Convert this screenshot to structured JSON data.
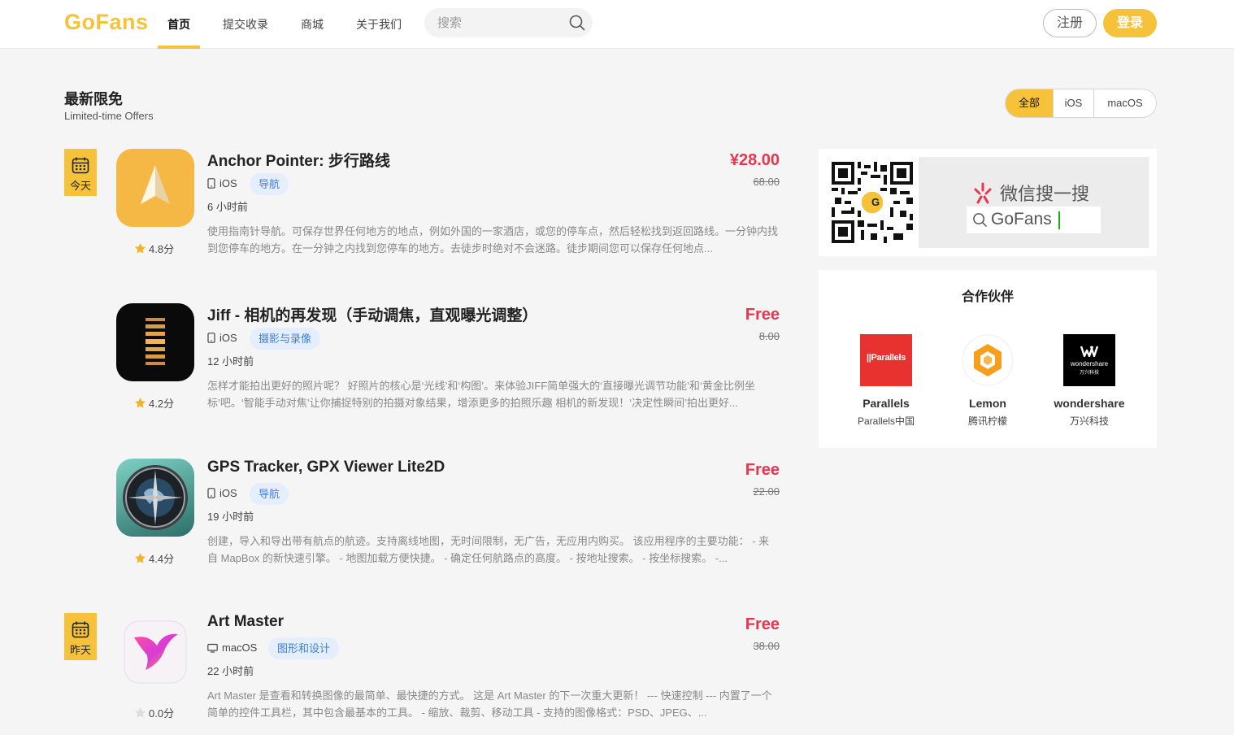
{
  "header": {
    "logo": "GoFans",
    "nav": [
      {
        "label": "首页"
      },
      {
        "label": "提交收录"
      },
      {
        "label": "商城"
      },
      {
        "label": "关于我们"
      }
    ],
    "search_placeholder": "搜索",
    "register_label": "注册",
    "login_label": "登录"
  },
  "section": {
    "title": "最新限免",
    "subtitle": "Limited-time Offers",
    "filters": [
      "全部",
      "iOS",
      "macOS"
    ],
    "active_filter": "全部"
  },
  "apps": [
    {
      "day": "今天",
      "name": "Anchor Pointer: 步行路线",
      "platform": "iOS",
      "platform_icon": "phone-icon",
      "category": "导航",
      "time": "6 小时前",
      "desc": "使用指南针导航。可保存世界任何地方的地点，例如外国的一家酒店，或您的停车点，然后轻松找到返回路线。一分钟内找到您停车的地方。在一分钟之内找到您停车的地方。去徒步时绝对不会迷路。徒步期间您可以保存任何地点...",
      "price": "¥28.00",
      "original_price": "68.00",
      "rating": "4.8分",
      "icon": "anchor-pointer-app-icon"
    },
    {
      "day": "",
      "name": "Jiff - 相机的再发现（手动调焦，直观曝光调整）",
      "platform": "iOS",
      "platform_icon": "phone-icon",
      "category": "摄影与录像",
      "time": "12 小时前",
      "desc": "怎样才能拍出更好的照片呢？ 好照片的核心是‘光线’和‘构图’。来体验JIFF简单强大的‘直接曝光调节功能’和‘黄金比例坐标’吧。‘智能手动对焦’让你捕捉特别的拍摄对象结果，增添更多的拍照乐趣 相机的新发现！‘决定性瞬间’拍出更好...",
      "price": "Free",
      "original_price": "8.00",
      "rating": "4.2分",
      "icon": "jiff-app-icon"
    },
    {
      "day": "",
      "name": "GPS Tracker, GPX Viewer Lite2D",
      "platform": "iOS",
      "platform_icon": "phone-icon",
      "category": "导航",
      "time": "19 小时前",
      "desc": "创建，导入和导出带有航点的航迹。支持离线地图，无时间限制，无广告，无应用内购买。 该应用程序的主要功能： - 来自 MapBox 的新快速引擎。 - 地图加载方便快捷。 - 确定任何航路点的高度。 - 按地址搜索。 - 按坐标搜索。 -...",
      "price": "Free",
      "original_price": "22.00",
      "rating": "4.4分",
      "icon": "gps-tracker-app-icon"
    },
    {
      "day": "昨天",
      "name": "Art Master",
      "platform": "macOS",
      "platform_icon": "monitor-icon",
      "category": "图形和设计",
      "time": "22 小时前",
      "desc": "Art Master 是查看和转换图像的最简单、最快捷的方式。 这是 Art Master 的下一次重大更新！ --- 快速控制 --- 内置了一个简单的控件工具栏，其中包含最基本的工具。 - 缩放、裁剪、移动工具 - 支持的图像格式：PSD、JPEG、...",
      "price": "Free",
      "original_price": "38.00",
      "rating": "0.0分",
      "icon": "art-master-app-icon"
    }
  ],
  "wechat": {
    "title": "微信搜一搜",
    "query": "GoFans",
    "logo_letter": "G"
  },
  "partners": {
    "title": "合作伙伴",
    "items": [
      {
        "name": "Parallels",
        "desc": "Parallels中国",
        "logo_text": "||Parallels"
      },
      {
        "name": "Lemon",
        "desc": "腾讯柠檬",
        "logo_text": ""
      },
      {
        "name": "wondershare",
        "desc": "万兴科技",
        "logo_text": "wondershare",
        "logo_sub": "万兴科技"
      }
    ]
  },
  "colors": {
    "accent": "#f5c23a",
    "price": "#e8364f",
    "tag_bg": "#e5eefc",
    "tag_text": "#3f7fd8"
  }
}
